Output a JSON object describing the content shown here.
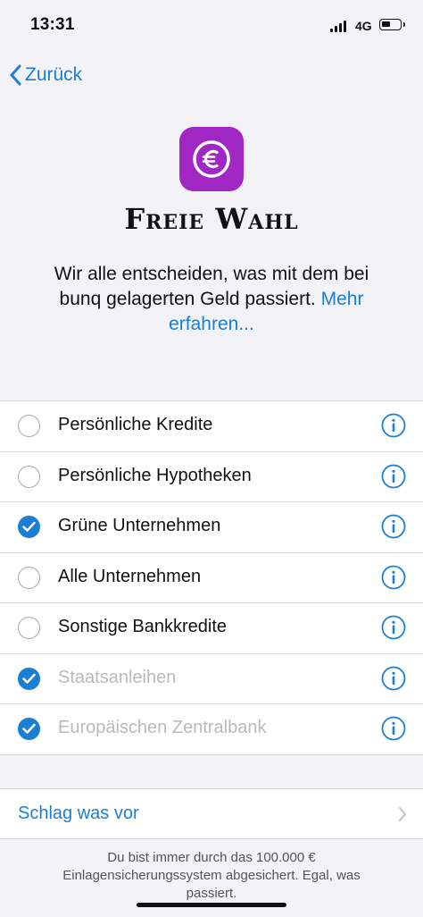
{
  "status": {
    "time": "13:31",
    "network": "4G"
  },
  "nav": {
    "back_label": "Zurück"
  },
  "header": {
    "title": "Freie Wahl",
    "description": "Wir alle entscheiden, was mit dem bei bunq gelagerten Geld passiert.",
    "more_link": "Mehr erfahren..."
  },
  "options": [
    {
      "label": "Persönliche Kredite",
      "checked": false,
      "disabled": false
    },
    {
      "label": "Persönliche Hypotheken",
      "checked": false,
      "disabled": false
    },
    {
      "label": "Grüne Unternehmen",
      "checked": true,
      "disabled": false
    },
    {
      "label": "Alle Unternehmen",
      "checked": false,
      "disabled": false
    },
    {
      "label": "Sonstige Bankkredite",
      "checked": false,
      "disabled": false
    },
    {
      "label": "Staatsanleihen",
      "checked": true,
      "disabled": true
    },
    {
      "label": "Europäischen Zentralbank",
      "checked": true,
      "disabled": true
    }
  ],
  "suggest": {
    "label": "Schlag was vor"
  },
  "footer": {
    "text": "Du bist immer durch das 100.000 € Einlagensicherungssystem abgesichert. Egal, was passiert."
  },
  "colors": {
    "accent": "#1a7fd4",
    "brand": "#a027c4"
  }
}
